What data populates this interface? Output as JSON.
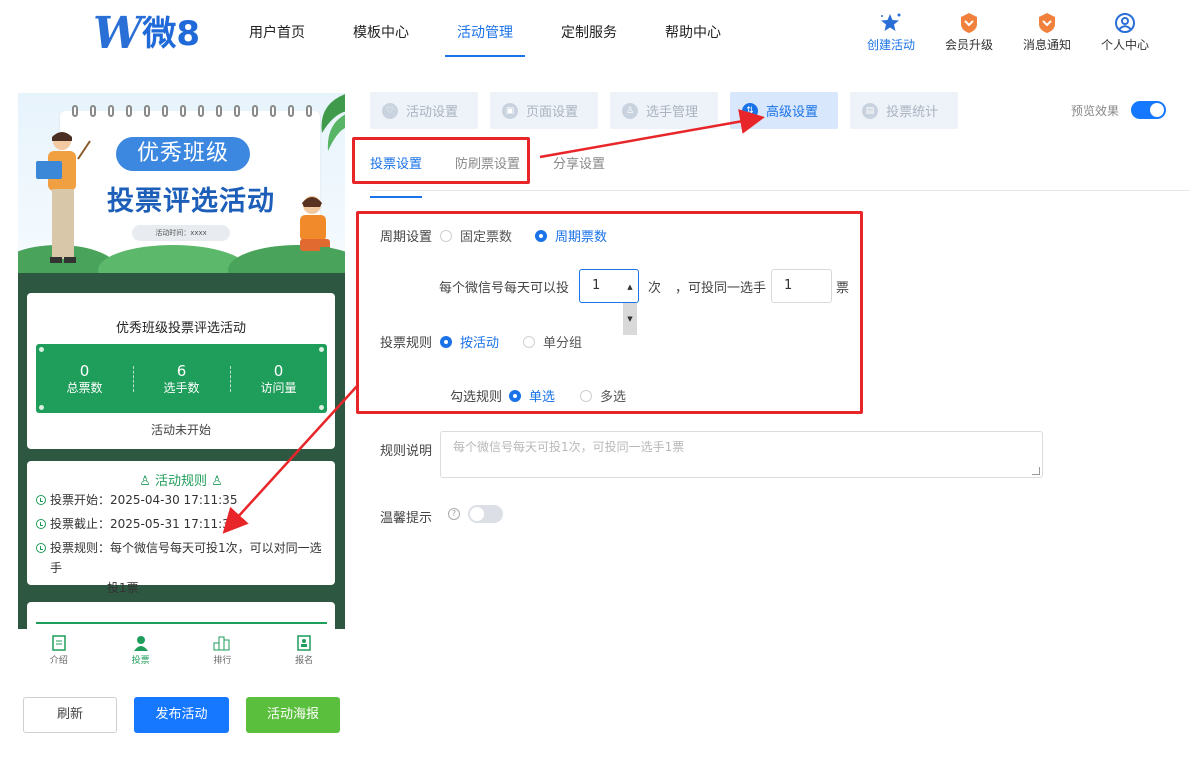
{
  "header": {
    "logo_text": "微8",
    "nav": [
      "用户首页",
      "模板中心",
      "活动管理",
      "定制服务",
      "帮助中心"
    ],
    "actions": [
      {
        "label": "创建活动",
        "icon": "star-icon"
      },
      {
        "label": "会员升级",
        "icon": "vip-badge-icon"
      },
      {
        "label": "消息通知",
        "icon": "bell-badge-icon"
      },
      {
        "label": "个人中心",
        "icon": "user-circle-icon"
      }
    ]
  },
  "preview": {
    "banner": {
      "pill": "优秀班级",
      "title": "投票评选活动",
      "time": "活动时间：xxxx"
    },
    "stats_card": {
      "title": "优秀班级投票评选活动",
      "stats": [
        {
          "value": "0",
          "label": "总票数"
        },
        {
          "value": "6",
          "label": "选手数"
        },
        {
          "value": "0",
          "label": "访问量"
        }
      ],
      "status": "活动未开始"
    },
    "rules_card": {
      "title": "活动规则",
      "start": "投票开始：2025-04-30 17:11:35",
      "end": "投票截止：2025-05-31 17:11:35",
      "rule_line1": "投票规则：每个微信号每天可投1次，可以对同一选手",
      "rule_line2": "投1票"
    },
    "tabbar": [
      "介绍",
      "投票",
      "排行",
      "报名"
    ]
  },
  "buttons": {
    "refresh": "刷新",
    "publish": "发布活动",
    "poster": "活动海报"
  },
  "settings": {
    "step_tabs": [
      "活动设置",
      "页面设置",
      "选手管理",
      "高级设置",
      "投票统计"
    ],
    "preview_label": "预览效果",
    "sub_tabs": [
      "投票设置",
      "防刷票设置",
      "分享设置"
    ],
    "period": {
      "label": "周期设置",
      "options": [
        "固定票数",
        "周期票数"
      ],
      "selected": "周期票数"
    },
    "daily": {
      "prefix": "每个微信号每天可以投",
      "value": "1",
      "unit": "次",
      "middle": "，可投同一选手",
      "same_value": "1",
      "same_unit": "票"
    },
    "vote_rule": {
      "label": "投票规则",
      "options": [
        "按活动",
        "单分组"
      ],
      "selected": "按活动"
    },
    "select_rule": {
      "label": "勾选规则",
      "options": [
        "单选",
        "多选"
      ],
      "selected": "单选"
    },
    "rule_desc": {
      "label": "规则说明",
      "placeholder": "每个微信号每天可投1次，可投同一选手1票"
    },
    "tip": {
      "label": "温馨提示"
    }
  },
  "colors": {
    "primary": "#1a73e8",
    "green": "#1f9d5a",
    "annotation": "#e8262a"
  }
}
